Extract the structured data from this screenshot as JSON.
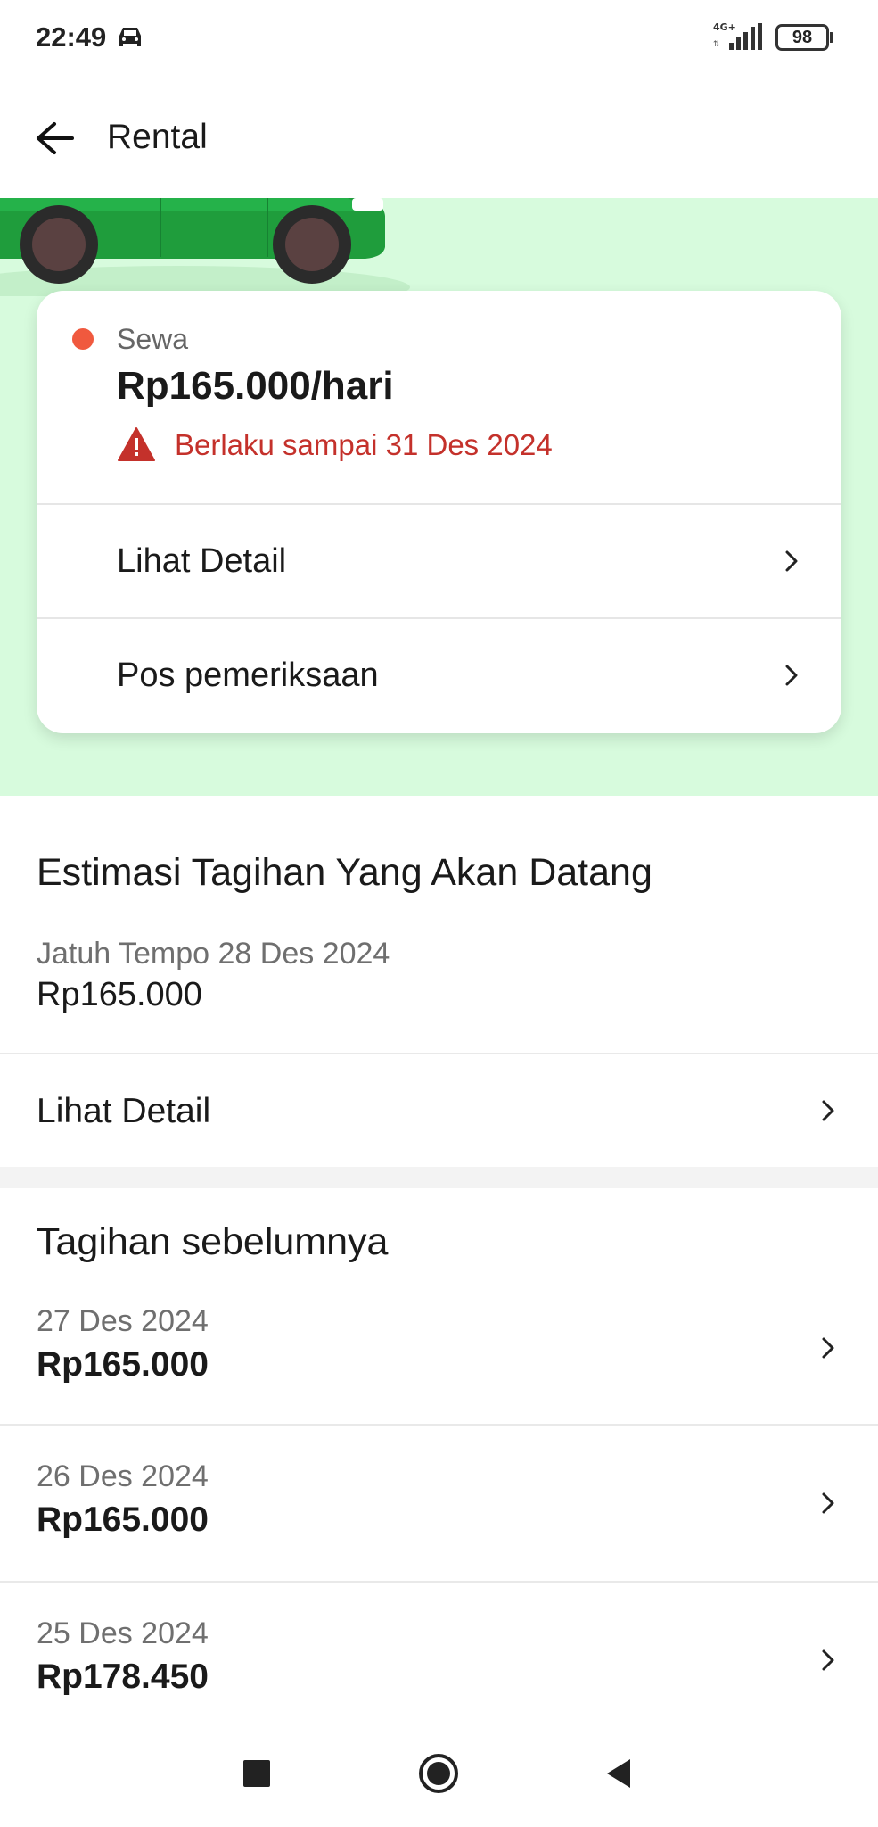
{
  "status_bar": {
    "time": "22:49",
    "network": "4G+",
    "battery": "98"
  },
  "app_bar": {
    "title": "Rental"
  },
  "rental_card": {
    "type": "Sewa",
    "price": "Rp165.000/hari",
    "validity": "Berlaku sampai 31 Des 2024",
    "rows": [
      {
        "label": "Lihat Detail"
      },
      {
        "label": "Pos pemeriksaan"
      }
    ]
  },
  "estimate": {
    "title": "Estimasi Tagihan Yang Akan Datang",
    "due": "Jatuh Tempo 28 Des 2024",
    "amount": "Rp165.000",
    "detail_label": "Lihat Detail"
  },
  "previous": {
    "title": "Tagihan sebelumnya",
    "bills": [
      {
        "date": "27 Des 2024",
        "amount": "Rp165.000"
      },
      {
        "date": "26 Des 2024",
        "amount": "Rp165.000"
      },
      {
        "date": "25 Des 2024",
        "amount": "Rp178.450"
      }
    ]
  },
  "colors": {
    "hero_bg": "#d7fbdd",
    "car_green": "#1f9d3c",
    "status_dot": "#f0593e",
    "warning": "#c4312b"
  },
  "icons": {
    "back": "arrow-left-icon",
    "chevron": "chevron-right-icon",
    "warning": "warning-triangle-icon"
  }
}
